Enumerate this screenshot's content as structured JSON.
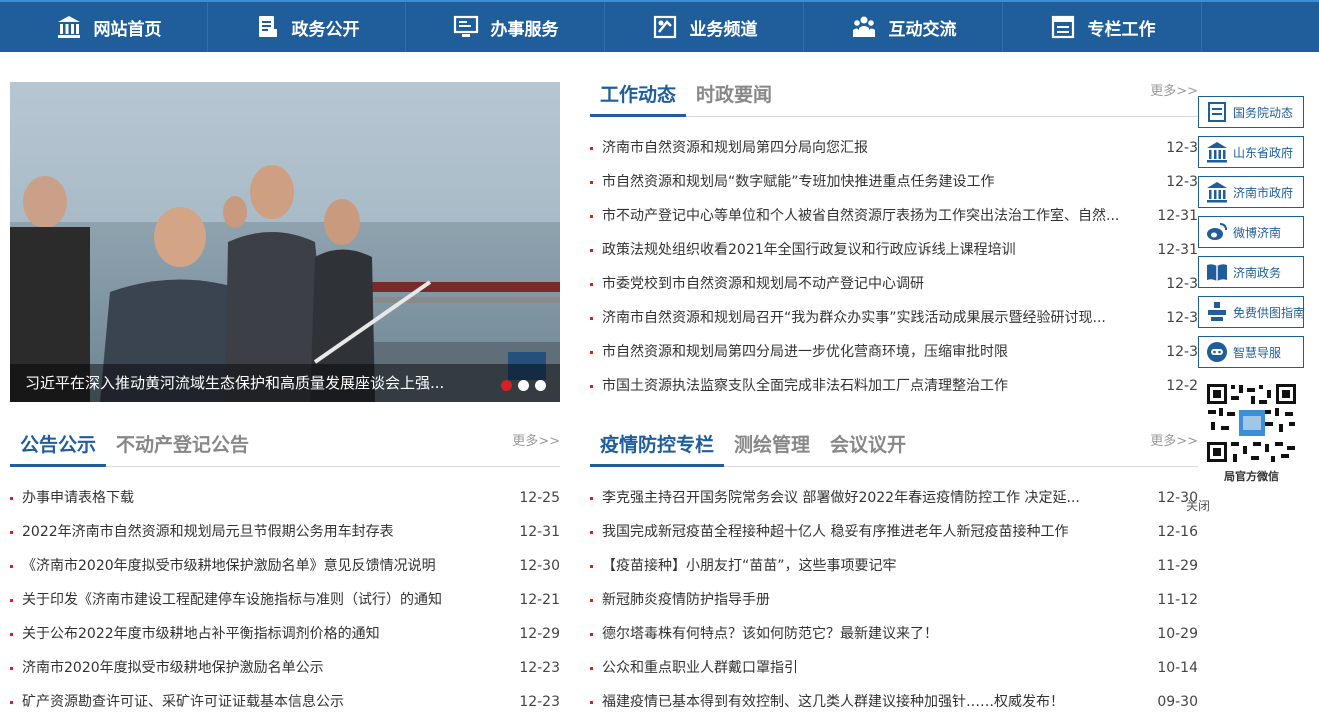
{
  "nav": {
    "items": [
      {
        "label": "网站首页",
        "icon": "building-icon"
      },
      {
        "label": "政务公开",
        "icon": "document-icon"
      },
      {
        "label": "办事服务",
        "icon": "monitor-icon"
      },
      {
        "label": "业务频道",
        "icon": "channel-icon"
      },
      {
        "label": "互动交流",
        "icon": "people-icon"
      },
      {
        "label": "专栏工作",
        "icon": "column-icon"
      }
    ]
  },
  "slider": {
    "caption": "习近平在深入推动黄河流域生态保护和高质量发展座谈会上强...",
    "active_dot": 0,
    "dot_count": 3
  },
  "news": {
    "tabs": [
      "工作动态",
      "时政要闻"
    ],
    "more": "更多>>",
    "items": [
      {
        "title": "济南市自然资源和规划局第四分局向您汇报",
        "date": "12-3"
      },
      {
        "title": "市自然资源和规划局“数字赋能”专班加快推进重点任务建设工作",
        "date": "12-3"
      },
      {
        "title": "市不动产登记中心等单位和个人被省自然资源厅表扬为工作突出法治工作室、自然...",
        "date": "12-31"
      },
      {
        "title": "政策法规处组织收看2021年全国行政复议和行政应诉线上课程培训",
        "date": "12-31"
      },
      {
        "title": "市委党校到市自然资源和规划局不动产登记中心调研",
        "date": "12-3"
      },
      {
        "title": "济南市自然资源和规划局召开“我为群众办实事”实践活动成果展示暨经验研讨现...",
        "date": "12-3"
      },
      {
        "title": "市自然资源和规划局第四分局进一步优化营商环境，压缩审批时限",
        "date": "12-3"
      },
      {
        "title": "市国土资源执法监察支队全面完成非法石料加工厂点清理整治工作",
        "date": "12-2"
      }
    ]
  },
  "notice": {
    "tabs": [
      "公告公示",
      "不动产登记公告"
    ],
    "more": "更多>>",
    "items": [
      {
        "title": "办事申请表格下载",
        "date": "12-25"
      },
      {
        "title": "2022年济南市自然资源和规划局元旦节假期公务用车封存表",
        "date": "12-31"
      },
      {
        "title": "《济南市2020年度拟受市级耕地保护激励名单》意见反馈情况说明",
        "date": "12-30"
      },
      {
        "title": "关于印发《济南市建设工程配建停车设施指标与准则（试行）的通知",
        "date": "12-21"
      },
      {
        "title": "关于公布2022年度市级耕地占补平衡指标调剂价格的通知",
        "date": "12-29"
      },
      {
        "title": "济南市2020年度拟受市级耕地保护激励名单公示",
        "date": "12-23"
      },
      {
        "title": "矿产资源勘查许可证、采矿许可证证载基本信息公示",
        "date": "12-23"
      }
    ]
  },
  "epidemic": {
    "tabs": [
      "疫情防控专栏",
      "测绘管理",
      "会议议开"
    ],
    "more": "更多>>",
    "items": [
      {
        "title": "李克强主持召开国务院常务会议 部署做好2022年春运疫情防控工作 决定延...",
        "date": "12-30"
      },
      {
        "title": "我国完成新冠疫苗全程接种超十亿人 稳妥有序推进老年人新冠疫苗接种工作",
        "date": "12-16"
      },
      {
        "title": "【疫苗接种】小朋友打“苗苗”，这些事项要记牢",
        "date": "11-29"
      },
      {
        "title": "新冠肺炎疫情防护指导手册",
        "date": "11-12"
      },
      {
        "title": "德尔塔毒株有何特点？该如何防范它？最新建议来了！",
        "date": "10-29"
      },
      {
        "title": "公众和重点职业人群戴口罩指引",
        "date": "10-14"
      },
      {
        "title": "福建疫情已基本得到有效控制、这几类人群建议接种加强针……权威发布！",
        "date": "09-30"
      }
    ]
  },
  "float": {
    "buttons": [
      {
        "label": "国务院动态",
        "icon": "state-council-icon"
      },
      {
        "label": "山东省政府",
        "icon": "gov-building-icon"
      },
      {
        "label": "济南市政府",
        "icon": "gov-building-icon"
      },
      {
        "label": "微博济南",
        "icon": "weibo-icon"
      },
      {
        "label": "济南政务",
        "icon": "book-icon"
      },
      {
        "label": "免费供图指南",
        "icon": "map-guide-icon"
      },
      {
        "label": "智慧导服",
        "icon": "robot-icon"
      }
    ],
    "qr_label": "局官方微信",
    "close": "关闭"
  },
  "colors": {
    "brand": "#1f5d9b",
    "accent": "#d71f26"
  }
}
